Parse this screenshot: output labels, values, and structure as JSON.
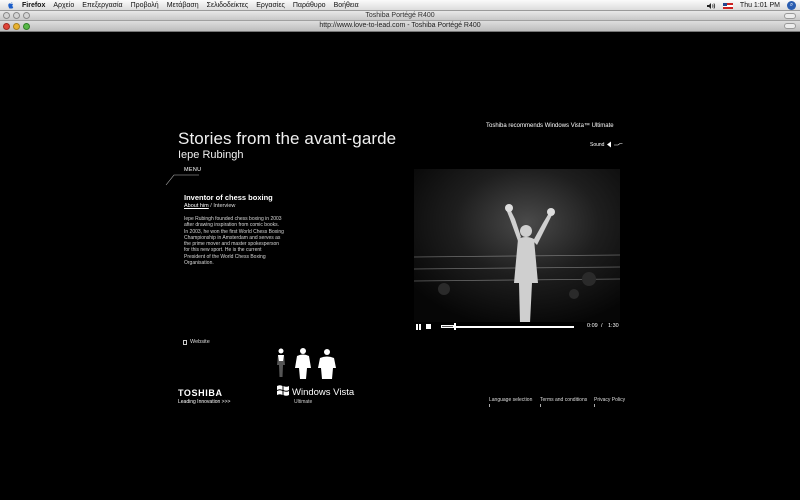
{
  "menubar": {
    "app": "Firefox",
    "items": [
      "Αρχείο",
      "Επεξεργασία",
      "Προβολή",
      "Μετάβαση",
      "Σελιδοδείκτες",
      "Εργασίες",
      "Παράθυρο",
      "Βοήθεια"
    ],
    "clock": "Thu 1:01 PM"
  },
  "window": {
    "title": "Toshiba Portégé R400",
    "url_line": "http://www.love-to-lead.com - Toshiba Portégé R400"
  },
  "page": {
    "heading": "Stories from the avant-garde",
    "person": "Iepe Rubingh",
    "menu": "MENU",
    "role": "Inventor of chess boxing",
    "about": "About him",
    "separator": "/",
    "interview": "Interview",
    "bio": "Iepe Rubingh founded chess boxing in 2003 after drawing inspiration from comic books. In 2003, he won the first World Chess Boxing Championship in Amsterdam and serves as the prime mover and master spokesperson for this new sport. He is the current President of the World Chess Boxing Organisation.",
    "website": "Website",
    "recommend": "Toshiba recommends Windows Vista™ Ultimate",
    "sound": "Sound"
  },
  "video": {
    "current_time": "0:09",
    "time_sep": "/",
    "total_time": "1:30",
    "progress": 0.1
  },
  "branding": {
    "toshiba": "TOSHIBA",
    "tagline": "Leading Innovation >>>",
    "vista": "Windows Vista",
    "vista_edition": "Ultimate"
  },
  "footer": {
    "language": "Language selection",
    "terms": "Terms and conditions",
    "privacy": "Privacy Policy"
  },
  "icons": [
    "apple-icon",
    "spotlight-icon",
    "volume-icon",
    "flag-icon",
    "sound-icon",
    "pause-icon",
    "stop-icon",
    "document-icon",
    "windows-flag-icon"
  ]
}
